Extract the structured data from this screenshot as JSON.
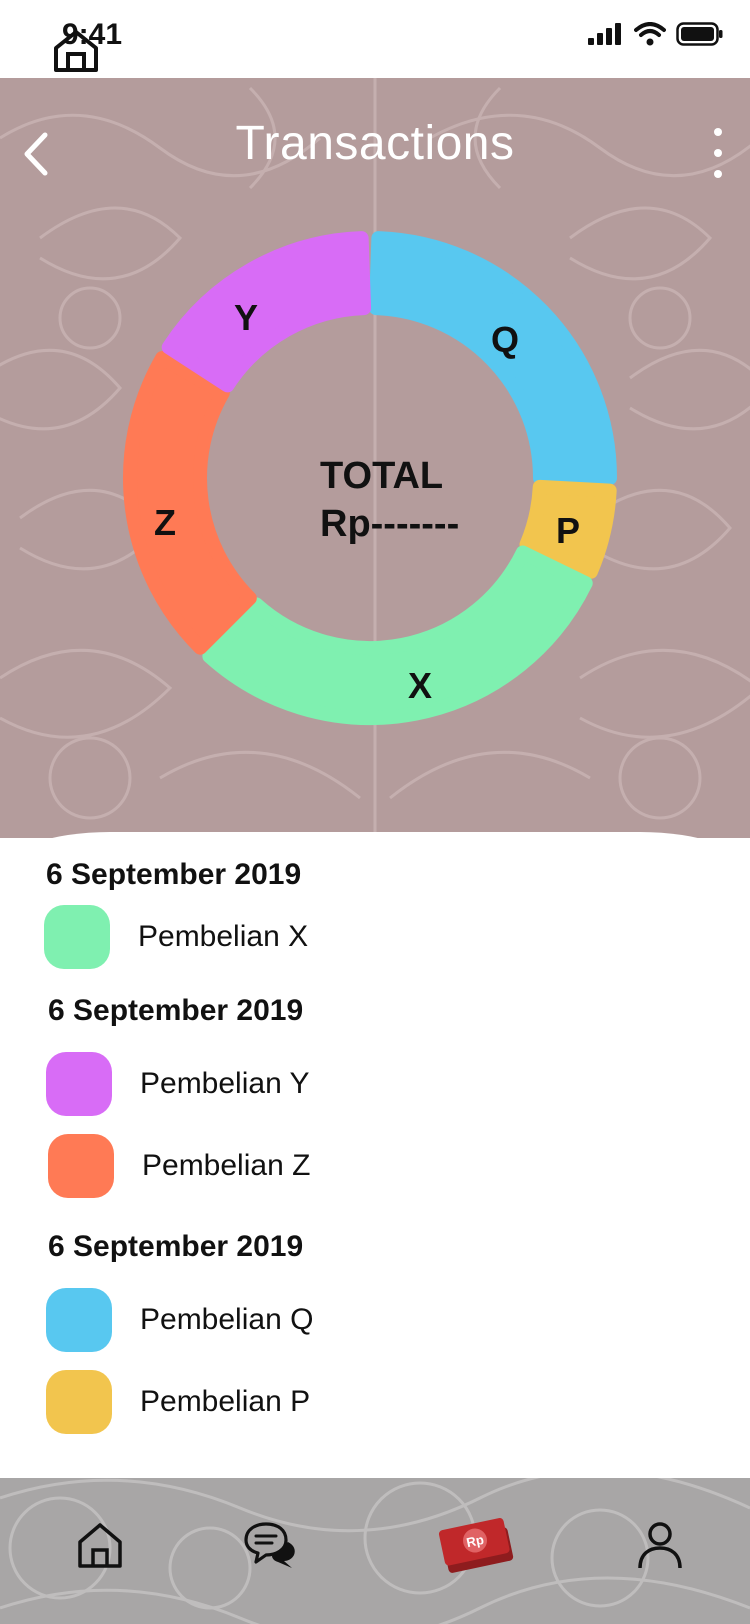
{
  "status": {
    "time": "9:41"
  },
  "header": {
    "title": "Transactions"
  },
  "total": {
    "label": "TOTAL",
    "value": "Rp-------"
  },
  "colors": {
    "X": "#7ff0b0",
    "Y": "#d86cf6",
    "Z": "#ff7a55",
    "Q": "#58c8f0",
    "P": "#f2c54e",
    "header_bg": "#b49c9c",
    "nav_bg": "#a8a6a6",
    "active_nav": "#c0282a"
  },
  "chart_data": {
    "type": "pie",
    "style": "donut",
    "categories": [
      "Q",
      "P",
      "X",
      "Z",
      "Y"
    ],
    "center_text": [
      "TOTAL",
      "Rp-------"
    ]
  },
  "transactions": [
    {
      "date": "6 September 2019",
      "items": [
        {
          "label": "Pembelian X",
          "key": "X"
        }
      ]
    },
    {
      "date": "6 September 2019",
      "items": [
        {
          "label": "Pembelian Y",
          "key": "Y"
        },
        {
          "label": "Pembelian Z",
          "key": "Z"
        }
      ]
    },
    {
      "date": "6 September 2019",
      "items": [
        {
          "label": "Pembelian Q",
          "key": "Q"
        },
        {
          "label": "Pembelian P",
          "key": "P"
        }
      ]
    }
  ],
  "nav": {
    "items": [
      "home-icon",
      "chat-icon",
      "money-icon",
      "profile-icon"
    ],
    "active": "money-icon",
    "money_badge": "Rp"
  }
}
